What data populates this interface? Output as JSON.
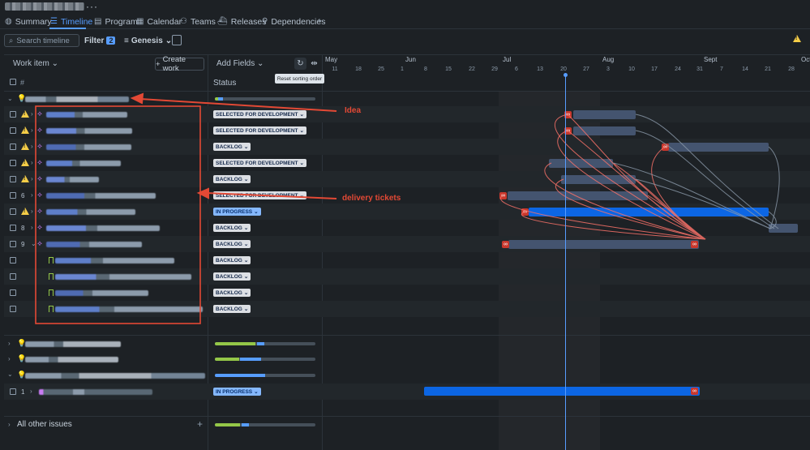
{
  "tabs": [
    {
      "label": "Summary",
      "icon": "globe-icon"
    },
    {
      "label": "Timeline",
      "icon": "timeline-icon"
    },
    {
      "label": "Program",
      "icon": "program-icon"
    },
    {
      "label": "Calendar",
      "icon": "calendar-icon"
    },
    {
      "label": "Teams",
      "icon": "teams-icon"
    },
    {
      "label": "Releases",
      "icon": "releases-icon"
    },
    {
      "label": "Dependencies",
      "icon": "dependencies-icon"
    }
  ],
  "toolbar": {
    "search_placeholder": "Search timeline",
    "filter_label": "Filter",
    "filter_count": "2",
    "genesis_label": "Genesis"
  },
  "header": {
    "work_item": "Work item",
    "create_work": "Create work",
    "hash": "#",
    "add_fields": "Add Fields",
    "status": "Status",
    "tooltip": "Reset sorting order"
  },
  "months": [
    "May",
    "Jun",
    "Jul",
    "Aug",
    "Sept",
    "Oct"
  ],
  "days": [
    "11",
    "18",
    "25",
    "1",
    "8",
    "15",
    "22",
    "29",
    "6",
    "13",
    "20",
    "27",
    "3",
    "10",
    "17",
    "24",
    "31",
    "7",
    "14",
    "21",
    "28"
  ],
  "rows": [
    {
      "num": "",
      "status": "SELECTED FOR DEVELOPMENT"
    },
    {
      "num": "",
      "status": "SELECTED FOR DEVELOPMENT"
    },
    {
      "num": "",
      "status": "BACKLOG"
    },
    {
      "num": "",
      "status": "SELECTED FOR DEVELOPMENT"
    },
    {
      "num": "",
      "status": "BACKLOG"
    },
    {
      "num": "6",
      "status": "SELECTED FOR DEVELOPMENT"
    },
    {
      "num": "",
      "status": "IN PROGRESS"
    },
    {
      "num": "8",
      "status": "BACKLOG"
    },
    {
      "num": "9",
      "status": "BACKLOG"
    },
    {
      "num": "",
      "status": "BACKLOG"
    },
    {
      "num": "",
      "status": "BACKLOG"
    },
    {
      "num": "",
      "status": "BACKLOG"
    },
    {
      "num": "",
      "status": "BACKLOG"
    }
  ],
  "bottom_row": {
    "num": "1",
    "status": "IN PROGRESS"
  },
  "all_other": "All other issues",
  "annotations": {
    "idea": "Idea",
    "delivery": "delivery tickets"
  },
  "colors": {
    "accent": "#579dff",
    "annotation": "#e34935",
    "bar_blue": "#0c66e4",
    "bar_slate": "#44546f"
  }
}
